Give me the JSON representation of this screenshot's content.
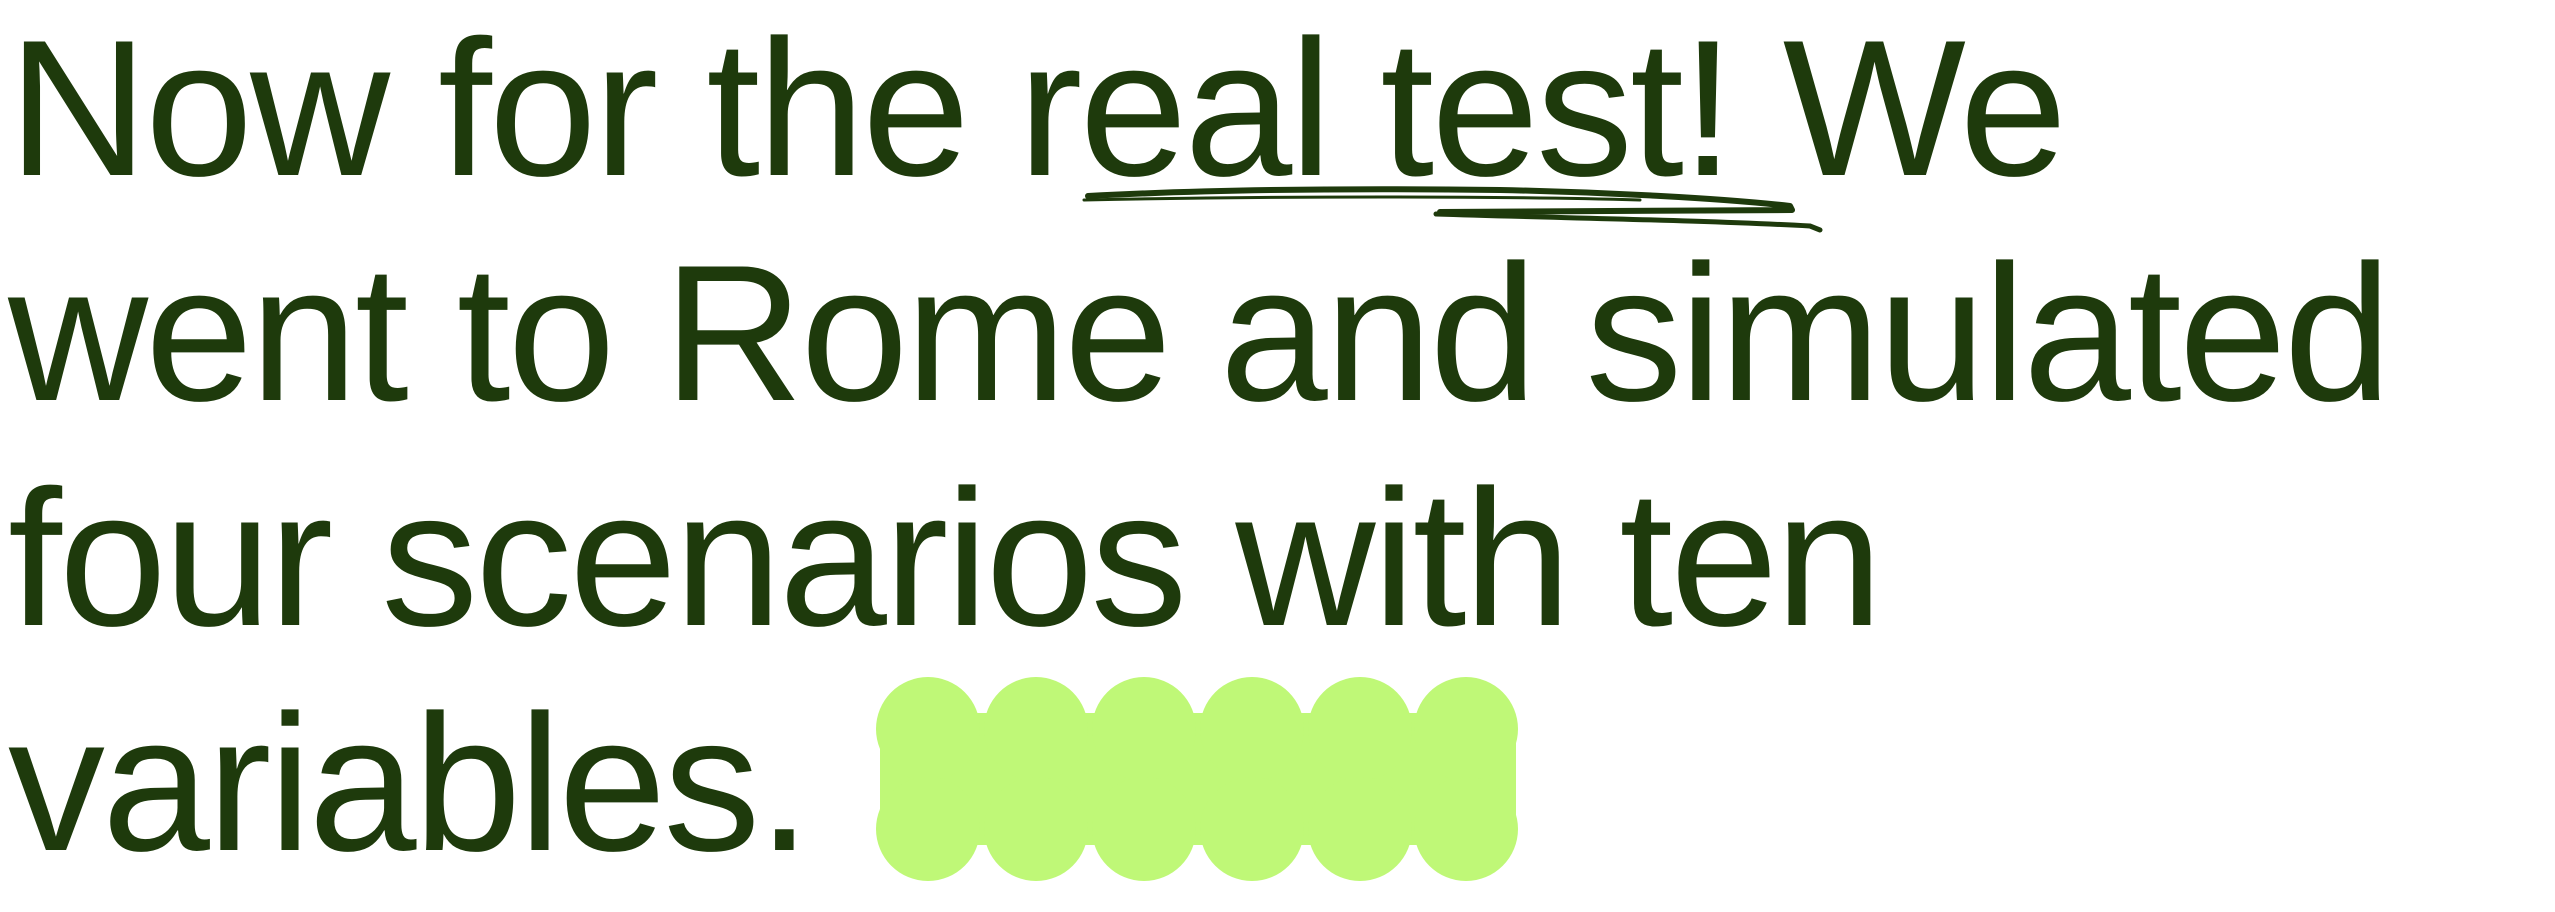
{
  "headline": {
    "line1": "Now for the real test! We",
    "line2": "went to Rome and simulated",
    "line3": "four scenarios with ten",
    "line4": "variables."
  },
  "colors": {
    "text": "#1e3a0c",
    "highlight_blob": "#bff877",
    "background": "#ffffff"
  }
}
